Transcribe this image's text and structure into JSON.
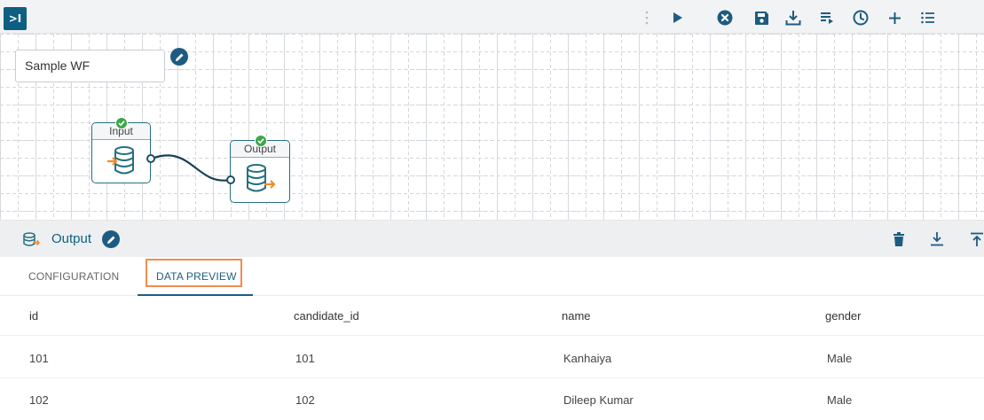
{
  "toolbar": {
    "toggle_label": ">I",
    "icons": [
      "kebab-icon",
      "play-icon",
      "stop-icon",
      "save-icon",
      "download-icon",
      "list-arrow-icon",
      "clock-icon",
      "plus-icon",
      "menu-icon"
    ],
    "colors": {
      "icon": "#1d5c80",
      "accent": "#0e5f82"
    }
  },
  "canvas": {
    "workflow_name": "Sample WF",
    "nodes": [
      {
        "label": "Input",
        "status": "success"
      },
      {
        "label": "Output",
        "status": "success"
      }
    ]
  },
  "panel": {
    "title": "Output",
    "actions": [
      "trash-icon",
      "download-icon",
      "upload-icon"
    ]
  },
  "tabs": [
    {
      "label": "CONFIGURATION",
      "active": false
    },
    {
      "label": "DATA PREVIEW",
      "active": true
    }
  ],
  "table": {
    "columns": [
      "id",
      "candidate_id",
      "name",
      "gender"
    ],
    "rows": [
      [
        "101",
        "101",
        "Kanhaiya",
        "Male"
      ],
      [
        "102",
        "102",
        "Dileep Kumar",
        "Male"
      ]
    ]
  }
}
